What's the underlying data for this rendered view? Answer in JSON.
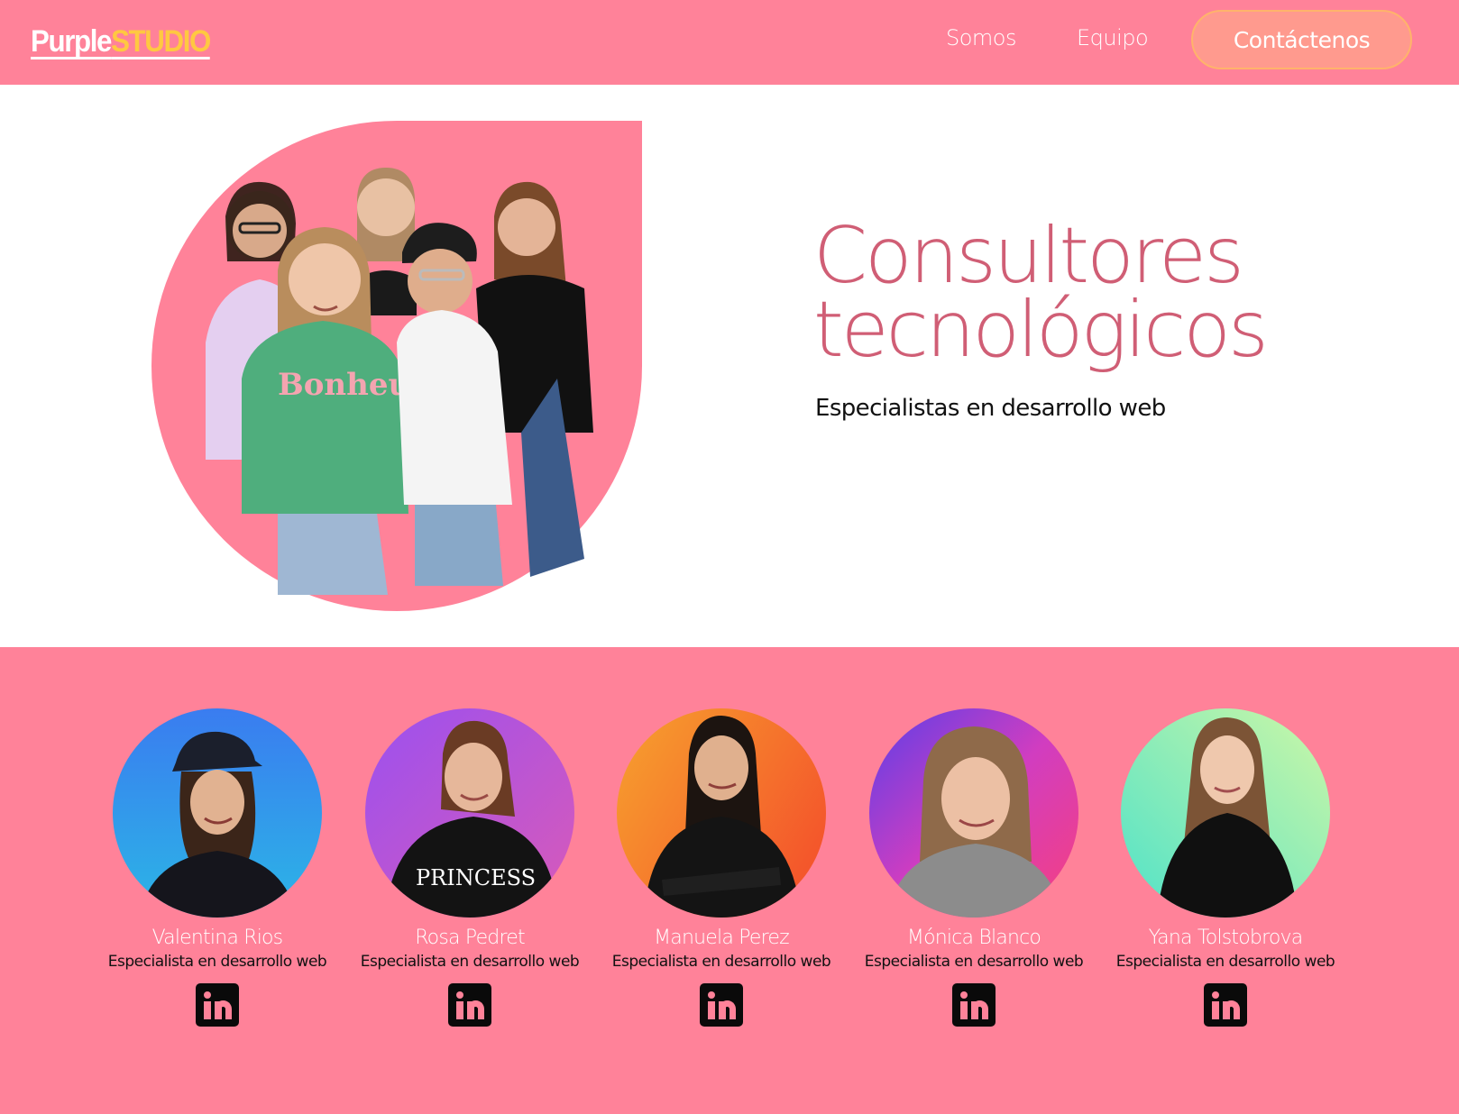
{
  "header": {
    "logo_part1": "Purple",
    "logo_part2": "STUDIO",
    "nav": {
      "somos": "Somos",
      "equipo": "Equipo",
      "contact": "Contáctenos"
    }
  },
  "hero": {
    "title_line1": "Consultores",
    "title_line2": "tecnológicos",
    "subtitle": "Especialistas en desarrollo web"
  },
  "team": [
    {
      "name": "Valentina Rios",
      "role": "Especialista en desarrollo web",
      "gradient": [
        "#3a7cf0",
        "#2bb6e6"
      ]
    },
    {
      "name": "Rosa Pedret",
      "role": "Especialista en desarrollo web",
      "gradient": [
        "#9b50f0",
        "#d95ab8"
      ]
    },
    {
      "name": "Manuela Perez",
      "role": "Especialista en desarrollo web",
      "gradient": [
        "#f7a22e",
        "#f4572b"
      ]
    },
    {
      "name": "Mónica Blanco",
      "role": "Especialista en desarrollo web",
      "gradient": [
        "#5b3fe8",
        "#f7407d"
      ]
    },
    {
      "name": "Yana Tolstobrova",
      "role": "Especialista en desarrollo web",
      "gradient": [
        "#cdf7a6",
        "#4fe2c9"
      ]
    }
  ],
  "colors": {
    "brand_pink": "#ff8299",
    "title_pink": "#d05e75",
    "logo_yellow": "#ffc841",
    "button_peach": "#ff9a8e"
  },
  "icons": [
    "linkedin-icon"
  ]
}
